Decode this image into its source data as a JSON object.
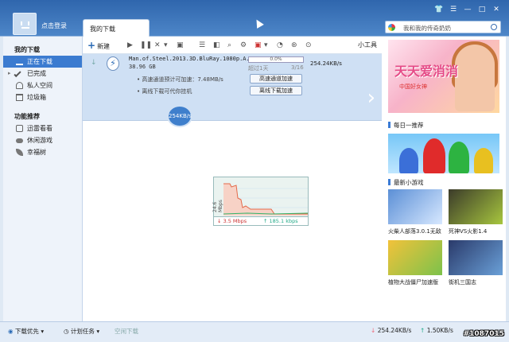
{
  "header": {
    "login": "点击登录",
    "tab": "我的下载",
    "search_placeholder": "我和我的传奇奶奶",
    "win_btns": [
      "👕",
      "☰",
      "—",
      "□",
      "✕"
    ]
  },
  "toolbar": {
    "new": "新建",
    "tools": "小工具",
    "icons": [
      "▶",
      "❚❚",
      "✕",
      "▾",
      "▣",
      "☰",
      "◧",
      "⌕",
      "⚙",
      "▣",
      "▾",
      "◔",
      "⊛",
      "⊙"
    ]
  },
  "sidebar": {
    "sec1": "我的下载",
    "items": [
      {
        "label": "正在下载",
        "icon": "download-icon"
      },
      {
        "label": "已完成",
        "icon": "check-icon"
      },
      {
        "label": "私人空间",
        "icon": "lock-icon"
      },
      {
        "label": "垃圾箱",
        "icon": "trash-icon"
      }
    ],
    "sec2": "功能推荐",
    "items2": [
      {
        "label": "迅雷看看",
        "icon": "tv-icon"
      },
      {
        "label": "休闲游戏",
        "icon": "gamepad-icon"
      },
      {
        "label": "幸福树",
        "icon": "leaf-icon"
      }
    ]
  },
  "task": {
    "name": "Man.of.Steel.2013.3D.BluRay.1080p.A...",
    "size": "38.96 GB",
    "progress_text": "0.0%",
    "progress": 0.0,
    "remain": "超过1天",
    "count": "3/16",
    "speed": "254.24KB/s",
    "line1": "• 高速通道预计可加速：7.48MB/s",
    "line2": "• 离线下载可代你挂机",
    "btn1": "高速通道加速",
    "btn2": "离线下载加速"
  },
  "bubble": "254KB/s",
  "graph": {
    "ylabel": "24.6 Mbps",
    "down": "3.5 Mbps",
    "up": "185.1 kbps"
  },
  "right": {
    "ad_title": "天天爱消消",
    "ad_sub": "中国好女神",
    "daily": "每日一推荐",
    "games_title": "最新小游戏",
    "games": [
      "火柴人部落3.0.1无敌",
      "死神VS火影1.4",
      "植物大战僵尸加速版",
      "街机三国志"
    ]
  },
  "status": {
    "priority": "下载优先",
    "plan": "计划任务",
    "space": "空闲下载",
    "down_speed": "254.24KB/s",
    "up_speed": "1.50KB/s",
    "watermark": "#1087015"
  },
  "colors": {
    "accent": "#3b7bd0",
    "titlebar": "#2f66ad"
  }
}
